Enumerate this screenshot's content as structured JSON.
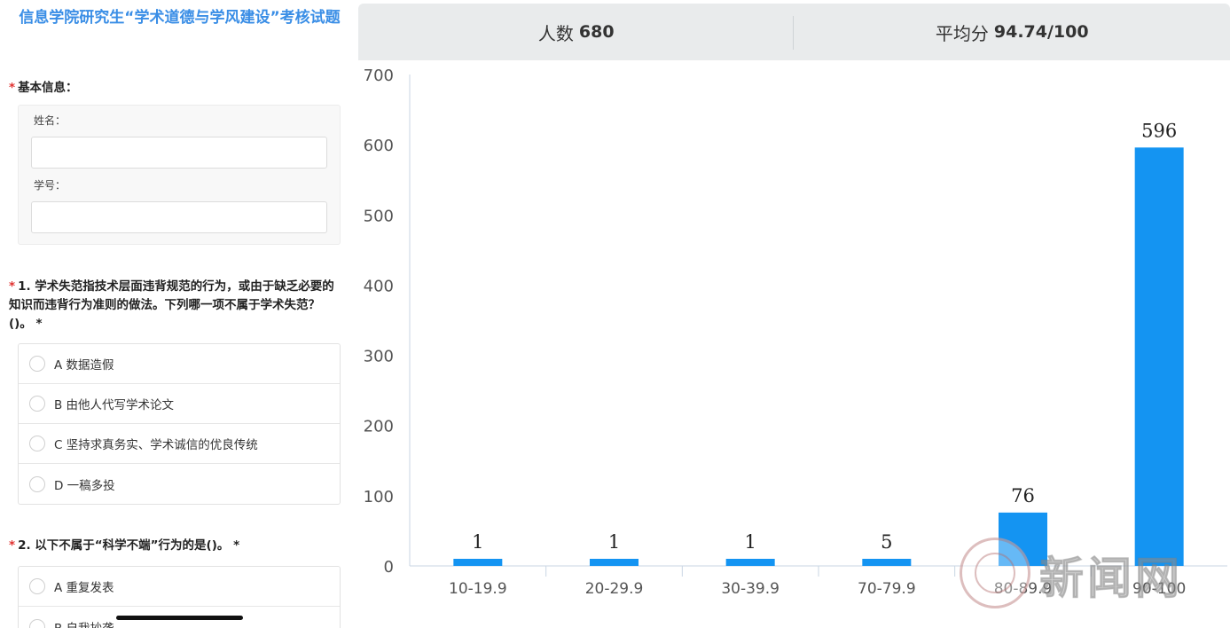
{
  "form": {
    "title": "信息学院研究生“学术道德与学风建设”考核试题",
    "basic_info": {
      "label": "基本信息：",
      "name_label": "姓名：",
      "id_label": "学号："
    },
    "questions": [
      {
        "label": "1. 学术失范指技术层面违背规范的行为，或由于缺乏必要的知识而违背行为准则的做法。下列哪一项不属于学术失范？()。 *",
        "options": [
          "A 数据造假",
          "B 由他人代写学术论文",
          "C 坚持求真务实、学术诚信的优良传统",
          "D 一稿多投"
        ]
      },
      {
        "label": "2. 以下不属于“科学不端”行为的是()。 *",
        "options": [
          "A 重复发表",
          "B 自我抄袭"
        ]
      }
    ]
  },
  "stats": {
    "count_label": "人数",
    "count_value": "680",
    "avg_label": "平均分",
    "avg_value": "94.74/100"
  },
  "chart_data": {
    "type": "bar",
    "categories": [
      "10-19.9",
      "20-29.9",
      "30-39.9",
      "70-79.9",
      "80-89.9",
      "90-100"
    ],
    "values": [
      1,
      1,
      1,
      5,
      76,
      596
    ],
    "ylim": [
      0,
      700
    ],
    "yticks": [
      0,
      100,
      200,
      300,
      400,
      500,
      600,
      700
    ],
    "bar_color": "#1494f2",
    "grid": false
  },
  "watermark": {
    "text": "新闻网"
  },
  "colors": {
    "title": "#3a8ee6",
    "required": "#e0312f",
    "header_bg": "#e9ebec"
  }
}
